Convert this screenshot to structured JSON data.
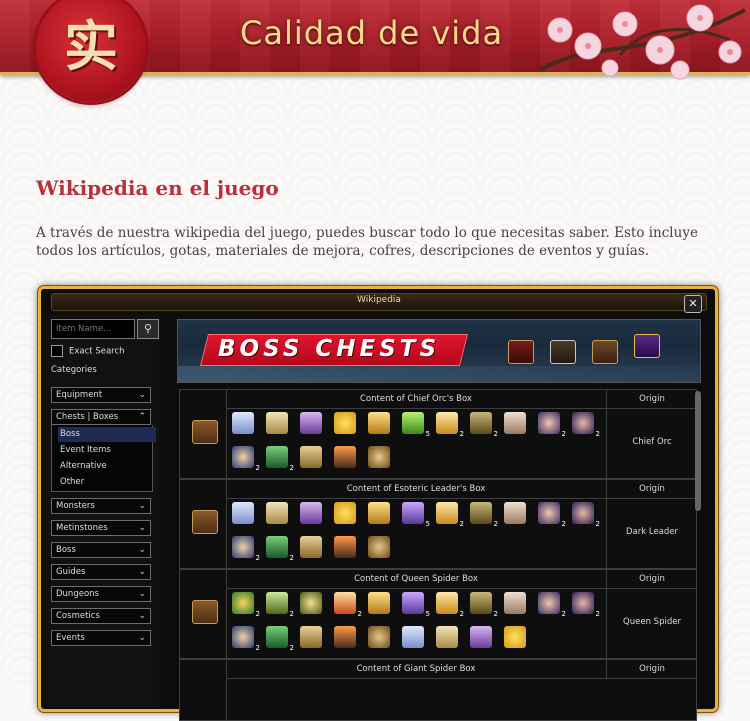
{
  "banner": {
    "seal_glyph": "实",
    "title": "Calidad de vida",
    "accent": "#a81d28",
    "gold": "#f6d98a"
  },
  "section": {
    "heading": "Wikipedia en el juego",
    "body": "A través de nuestra wikipedia del juego, puedes buscar todo lo que necesitas saber. Esto incluye todos los artículos, gotas, materiales de mejora, cofres, descripciones de eventos y guías."
  },
  "game_window": {
    "title": "Wikipedia",
    "close_icon": "close-icon",
    "search": {
      "placeholder": "Item Name...",
      "icon": "search-icon"
    },
    "exact_search_label": "Exact Search",
    "categories_label": "Categories",
    "categories": [
      {
        "label": "Equipment",
        "expanded": false
      },
      {
        "label": "Chests | Boxes",
        "expanded": true,
        "items": [
          "Boss",
          "Event Items",
          "Alternative",
          "Other"
        ],
        "selected": "Boss"
      },
      {
        "label": "Monsters",
        "expanded": false
      },
      {
        "label": "Metinstones",
        "expanded": false
      },
      {
        "label": "Boss",
        "expanded": false
      },
      {
        "label": "Guides",
        "expanded": false
      },
      {
        "label": "Dungeons",
        "expanded": false
      },
      {
        "label": "Cosmetics",
        "expanded": false
      },
      {
        "label": "Events",
        "expanded": false
      }
    ],
    "banner_text": "BOSS CHESTS",
    "origin_header": "Origin",
    "boxes": [
      {
        "title": "Content of Chief Orc's Box",
        "origin": "Chief Orc",
        "items": [
          {
            "icon": "potion-icon",
            "count": ""
          },
          {
            "icon": "scroll-icon",
            "count": ""
          },
          {
            "icon": "purple-scroll-icon",
            "count": ""
          },
          {
            "icon": "flower-icon",
            "count": ""
          },
          {
            "icon": "gold-piece-icon",
            "count": ""
          },
          {
            "icon": "leaf-icon",
            "count": "5"
          },
          {
            "icon": "crystal-icon",
            "count": "2"
          },
          {
            "icon": "treasure-chest-icon",
            "count": "2"
          },
          {
            "icon": "shell-icon",
            "count": ""
          },
          {
            "icon": "orb-icon",
            "count": "2"
          },
          {
            "icon": "dark-orb-icon",
            "count": "2"
          },
          {
            "icon": "spirit-stone-icon",
            "count": "2"
          },
          {
            "icon": "green-chest-icon",
            "count": "2"
          },
          {
            "icon": "bundle-icon",
            "count": ""
          },
          {
            "icon": "flame-stone-icon",
            "count": ""
          },
          {
            "icon": "pouch-icon",
            "count": ""
          }
        ]
      },
      {
        "title": "Content of Esoteric Leader's Box",
        "origin": "Dark Leader",
        "items": [
          {
            "icon": "potion-icon",
            "count": ""
          },
          {
            "icon": "scroll-icon",
            "count": ""
          },
          {
            "icon": "purple-scroll-icon",
            "count": ""
          },
          {
            "icon": "flower-icon",
            "count": ""
          },
          {
            "icon": "gold-piece-icon",
            "count": ""
          },
          {
            "icon": "star-crystal-icon",
            "count": "5"
          },
          {
            "icon": "crystal-icon",
            "count": "2"
          },
          {
            "icon": "treasure-chest-icon",
            "count": "2"
          },
          {
            "icon": "shell-icon",
            "count": ""
          },
          {
            "icon": "orb-icon",
            "count": "2"
          },
          {
            "icon": "dark-orb-icon",
            "count": "2"
          },
          {
            "icon": "spirit-stone-icon",
            "count": "2"
          },
          {
            "icon": "green-chest-icon",
            "count": "2"
          },
          {
            "icon": "bundle-icon",
            "count": ""
          },
          {
            "icon": "flame-stone-icon",
            "count": ""
          },
          {
            "icon": "pouch-icon",
            "count": ""
          }
        ]
      },
      {
        "title": "Content of Queen Spider Box",
        "origin": "Queen Spider",
        "items": [
          {
            "icon": "wreath-icon",
            "count": "2"
          },
          {
            "icon": "herb-icon",
            "count": "2"
          },
          {
            "icon": "ore-icon",
            "count": ""
          },
          {
            "icon": "map-icon",
            "count": "2"
          },
          {
            "icon": "gold-piece-icon",
            "count": ""
          },
          {
            "icon": "star-crystal-icon",
            "count": "5"
          },
          {
            "icon": "crystal-icon",
            "count": "2"
          },
          {
            "icon": "treasure-chest-icon",
            "count": "2"
          },
          {
            "icon": "shell-icon",
            "count": ""
          },
          {
            "icon": "orb-icon",
            "count": "2"
          },
          {
            "icon": "dark-orb-icon",
            "count": "2"
          },
          {
            "icon": "spirit-stone-icon",
            "count": "2"
          },
          {
            "icon": "green-chest-icon",
            "count": "2"
          },
          {
            "icon": "bundle-icon",
            "count": ""
          },
          {
            "icon": "flame-stone-icon",
            "count": ""
          },
          {
            "icon": "pouch-icon",
            "count": ""
          },
          {
            "icon": "potion-icon",
            "count": ""
          },
          {
            "icon": "scroll-icon",
            "count": ""
          },
          {
            "icon": "purple-scroll-icon",
            "count": ""
          },
          {
            "icon": "flower-icon",
            "count": ""
          }
        ]
      },
      {
        "title": "Content of Giant Spider Box",
        "origin": "",
        "items": []
      }
    ]
  }
}
